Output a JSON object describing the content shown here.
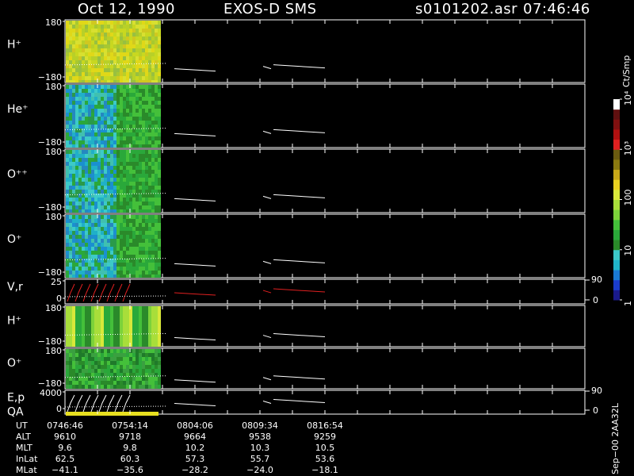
{
  "title": {
    "date": "Oct 12, 1990",
    "instrument": "EXOS-D SMS",
    "file": "s0101202.asr",
    "time": "07:46:46"
  },
  "colorbar": {
    "unit": "Ct/Smp",
    "colors": [
      "#1a1a8c",
      "#1a3ccc",
      "#1a7ad4",
      "#20b4c8",
      "#3cc8c8",
      "#2a8a2a",
      "#2aa83a",
      "#44c03a",
      "#7cd23a",
      "#a8de3a",
      "#d8e83a",
      "#e8d020",
      "#c8a818",
      "#8a7a10",
      "#6a5a10",
      "#e02020",
      "#b01010",
      "#801010",
      "#601010",
      "#ffffff"
    ],
    "ticks": [
      {
        "level": 0.0,
        "label": "1"
      },
      {
        "level": 0.25,
        "label": "10"
      },
      {
        "level": 0.5,
        "label": "100"
      },
      {
        "level": 0.75,
        "label": "10³"
      },
      {
        "level": 1.0,
        "label": "10⁴"
      }
    ]
  },
  "panels": [
    {
      "label": "H⁺",
      "ymax": "180",
      "ymin": "−180",
      "type": "spectrogram",
      "palette": "yellow"
    },
    {
      "label": "He⁺",
      "ymax": "180",
      "ymin": "−180",
      "type": "spectrogram",
      "palette": "blue"
    },
    {
      "label": "O⁺⁺",
      "ymax": "180",
      "ymin": "−180",
      "type": "spectrogram",
      "palette": "blue"
    },
    {
      "label": "O⁺",
      "ymax": "180",
      "ymin": "−180",
      "type": "spectrogram",
      "palette": "blue"
    },
    {
      "label": "V,r",
      "ymax": "25",
      "ymin": "0",
      "type": "line",
      "right_top": "90",
      "right_bottom": "0"
    },
    {
      "label": "H⁺",
      "ymax": "180",
      "ymin": "−180",
      "type": "spectrogram",
      "palette": "stripes"
    },
    {
      "label": "O⁺",
      "ymax": "180",
      "ymin": "−180",
      "type": "spectrogram",
      "palette": "green"
    },
    {
      "label": "E,p",
      "label2": "QA",
      "ymax": "4000",
      "ymin": "0",
      "type": "line",
      "right_top": "90",
      "right_bottom": "0"
    }
  ],
  "chart_data": {
    "type": "heatmap",
    "data_coverage_fraction": 0.18,
    "trace_segments": [
      [
        0.07,
        0.48,
        0.02
      ],
      [
        0.14,
        0.19,
        0.01
      ],
      [
        0.09,
        0.12,
        0.01
      ],
      [
        0.29,
        0.6,
        0.03
      ]
    ]
  },
  "time_table": {
    "row_labels": [
      "UT",
      "ALT",
      "MLT",
      "InLat",
      "MLat"
    ],
    "columns": [
      [
        "0746:46",
        "9610",
        "9.6",
        "62.5",
        "−41.1"
      ],
      [
        "0754:14",
        "9718",
        "9.8",
        "60.3",
        "−35.6"
      ],
      [
        "0804:06",
        "9664",
        "10.2",
        "57.3",
        "−28.2"
      ],
      [
        "0809:34",
        "9538",
        "10.3",
        "55.7",
        "−24.0"
      ],
      [
        "0816:54",
        "9259",
        "10.5",
        "53.6",
        "−18.1"
      ]
    ]
  },
  "footer_id": "Sep−00 2AA32L"
}
